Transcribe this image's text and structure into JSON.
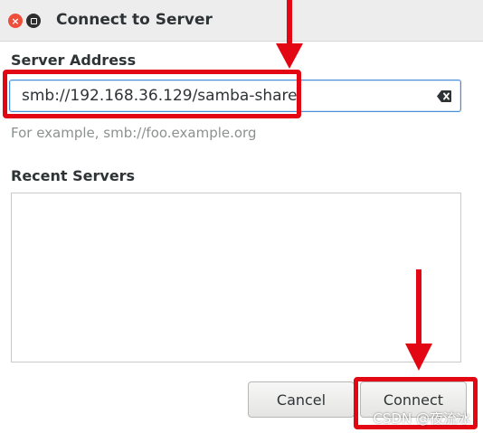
{
  "window": {
    "title": "Connect to Server"
  },
  "server_address": {
    "label": "Server Address",
    "value": "smb://192.168.36.129/samba-share",
    "example": "For example, smb://foo.example.org"
  },
  "recent_servers": {
    "label": "Recent Servers",
    "items": []
  },
  "buttons": {
    "cancel": "Cancel",
    "connect": "Connect"
  },
  "annotations": {
    "color": "#e30613"
  },
  "watermark": "CSDN @夜流冰",
  "icons": {
    "close": "close-icon",
    "maximize": "maximize-icon",
    "clear": "clear-text-icon"
  }
}
